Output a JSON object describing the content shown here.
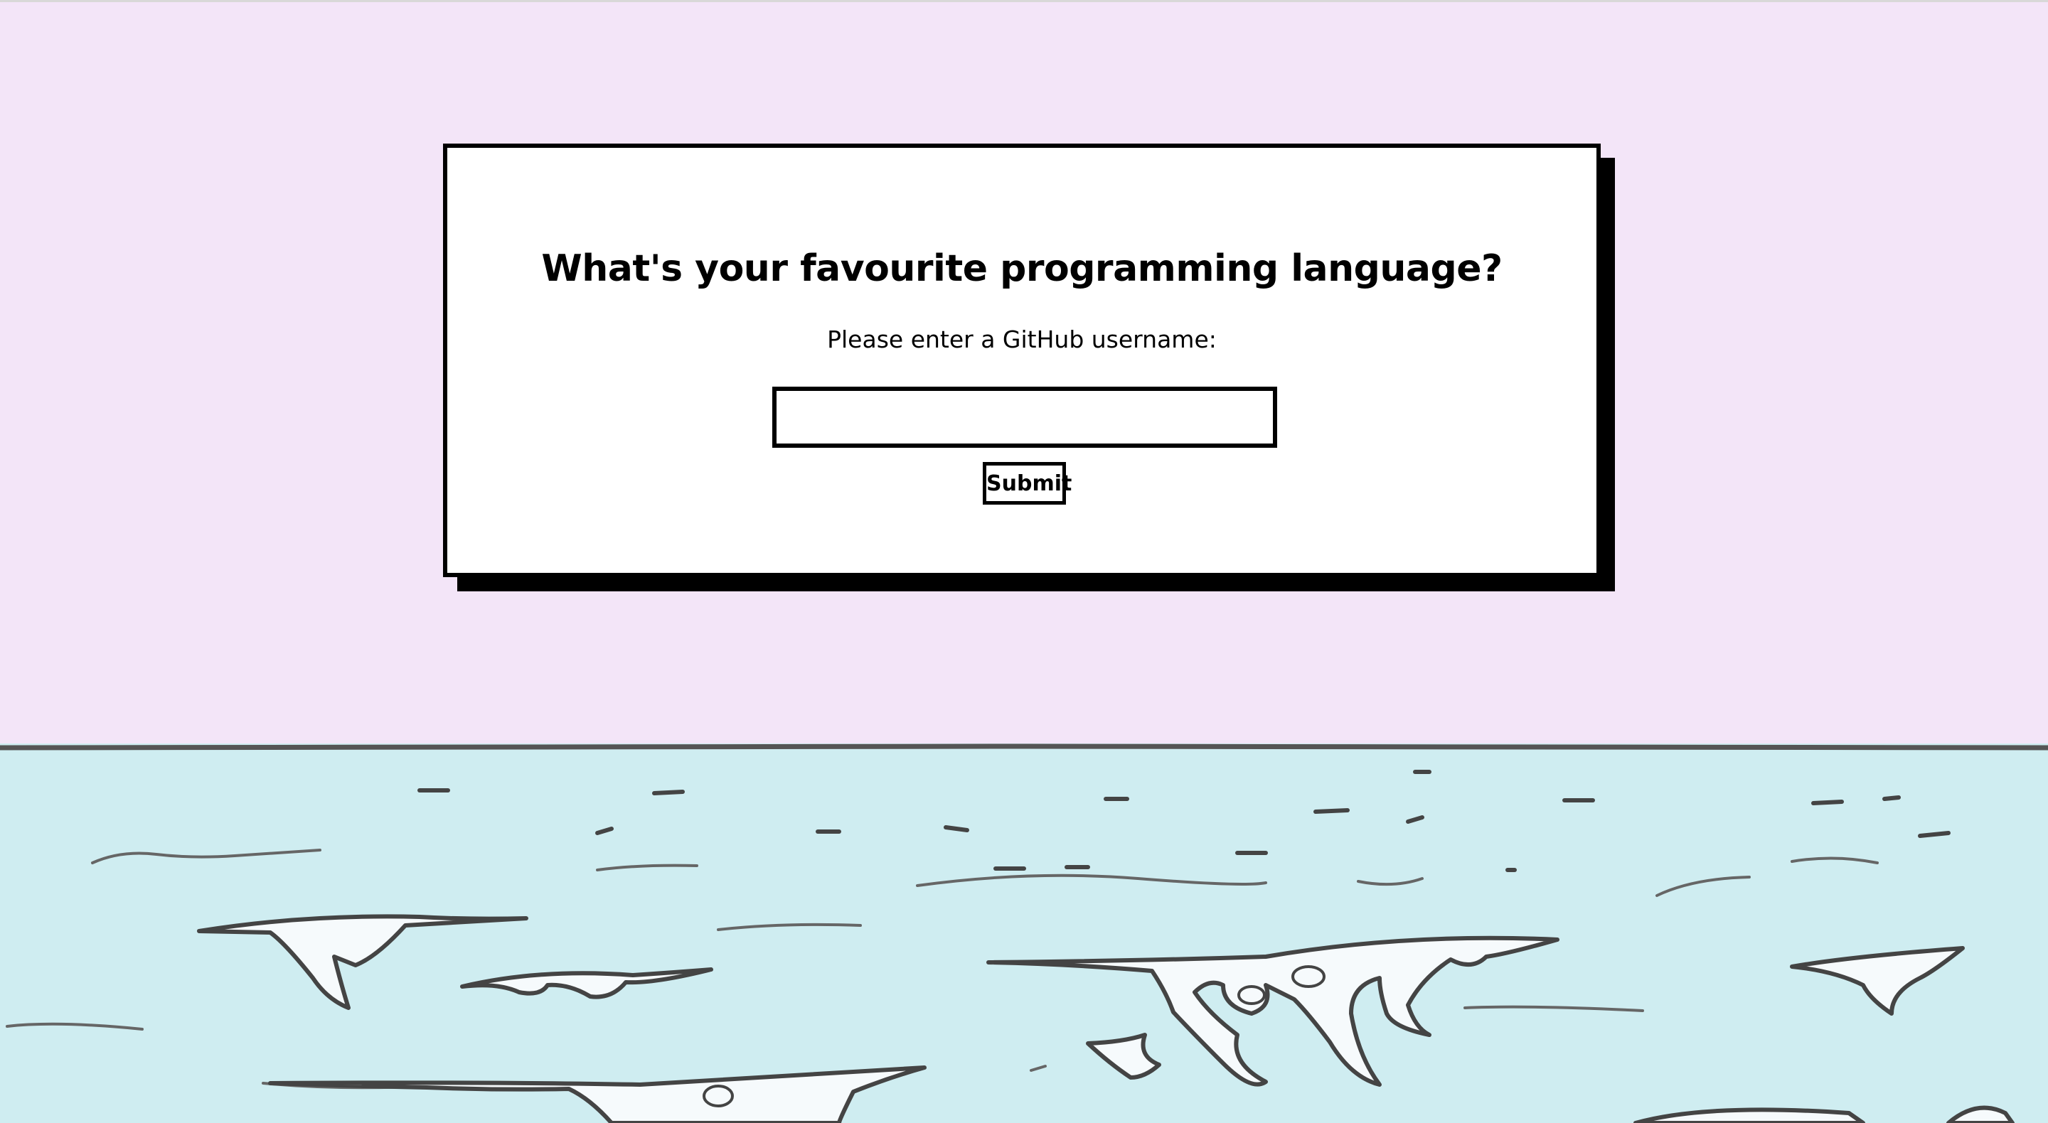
{
  "page": {
    "background_color": "#f3e5f8",
    "sea_color": "#cfedf1"
  },
  "form": {
    "title": "What's your favourite programming language?",
    "prompt": "Please enter a GitHub username:",
    "username_value": "",
    "submit_label": "Submit"
  }
}
